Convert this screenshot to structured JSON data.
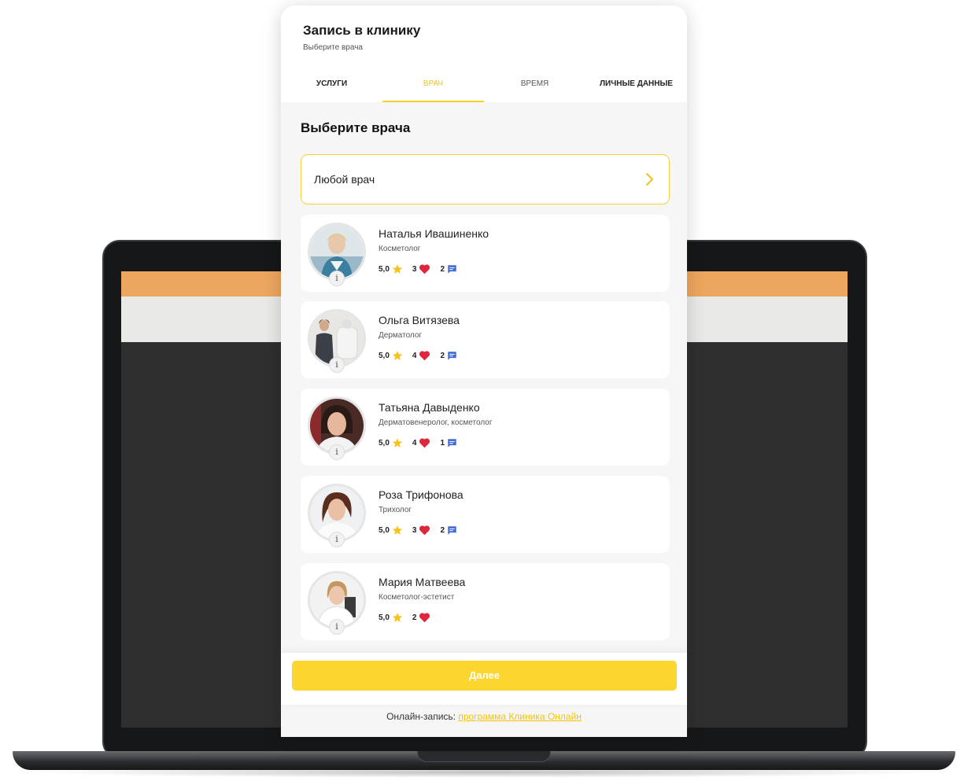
{
  "widget": {
    "title": "Запись в клинику",
    "subtitle": "Выберите врача",
    "tabs": [
      {
        "label": "УСЛУГИ"
      },
      {
        "label": "ВРАЧ"
      },
      {
        "label": "ВРЕМЯ"
      },
      {
        "label": "ЛИЧНЫЕ ДАННЫЕ"
      }
    ],
    "active_tab": "ВРАЧ"
  },
  "main": {
    "section_title": "Выберите врача",
    "any_doctor_label": "Любой врач"
  },
  "doctors": [
    {
      "name": "Наталья Ивашиненко",
      "specialty": "Косметолог",
      "rating": "5,0",
      "likes": "3",
      "reviews": "2"
    },
    {
      "name": "Ольга Витязева",
      "specialty": "Дерматолог",
      "rating": "5,0",
      "likes": "4",
      "reviews": "2"
    },
    {
      "name": "Татьяна Давыденко",
      "specialty": "Дерматовенеролог, косметолог",
      "rating": "5,0",
      "likes": "4",
      "reviews": "1"
    },
    {
      "name": "Роза Трифонова",
      "specialty": "Трихолог",
      "rating": "5,0",
      "likes": "3",
      "reviews": "2"
    },
    {
      "name": "Мария Матвеева",
      "specialty": "Косметолог-эстетист",
      "rating": "5,0",
      "likes": "2",
      "reviews": ""
    }
  ],
  "footer": {
    "next_label": "Далее",
    "powered_prefix": "Онлайн-запись: ",
    "powered_link": "программа Клиника Онлайн"
  },
  "icons": {
    "rating": "star-icon",
    "likes": "heart-icon",
    "reviews": "comment-icon",
    "info": "info-icon",
    "chevron": "chevron-right-icon"
  },
  "colors": {
    "accent": "#fcd62f",
    "star": "#f6c21c",
    "heart": "#e0263c",
    "comment": "#3e6ad6",
    "screen_orange": "#eda65e"
  }
}
